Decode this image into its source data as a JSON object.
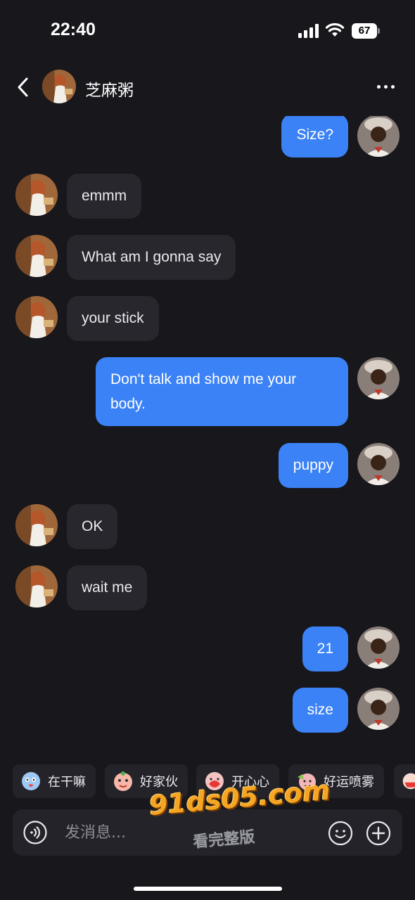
{
  "status_bar": {
    "time": "22:40",
    "battery": "67"
  },
  "header": {
    "contact_name": "芝麻粥"
  },
  "messages": [
    {
      "from": "me",
      "text": "Size?"
    },
    {
      "from": "them",
      "text": "emmm"
    },
    {
      "from": "them",
      "text": "What am I gonna say"
    },
    {
      "from": "them",
      "text": "your stick"
    },
    {
      "from": "me",
      "text": "Don't talk and show me your body."
    },
    {
      "from": "me",
      "text": "puppy"
    },
    {
      "from": "them",
      "text": "OK"
    },
    {
      "from": "them",
      "text": "wait me"
    },
    {
      "from": "me",
      "text": "21"
    },
    {
      "from": "me",
      "text": "size"
    }
  ],
  "quick_replies": [
    {
      "label": "在干嘛",
      "icon": "sticker-icon"
    },
    {
      "label": "好家伙",
      "icon": "sticker-icon"
    },
    {
      "label": "开心心",
      "icon": "sticker-icon"
    },
    {
      "label": "好运喷雾",
      "icon": "sticker-icon"
    }
  ],
  "input": {
    "placeholder": "发消息..."
  },
  "watermark": {
    "domain": "91ds05.com",
    "subtitle": "看完整版"
  },
  "colors": {
    "background": "#17171c",
    "bubble_me": "#3b82f6",
    "bubble_them": "#27272d"
  }
}
